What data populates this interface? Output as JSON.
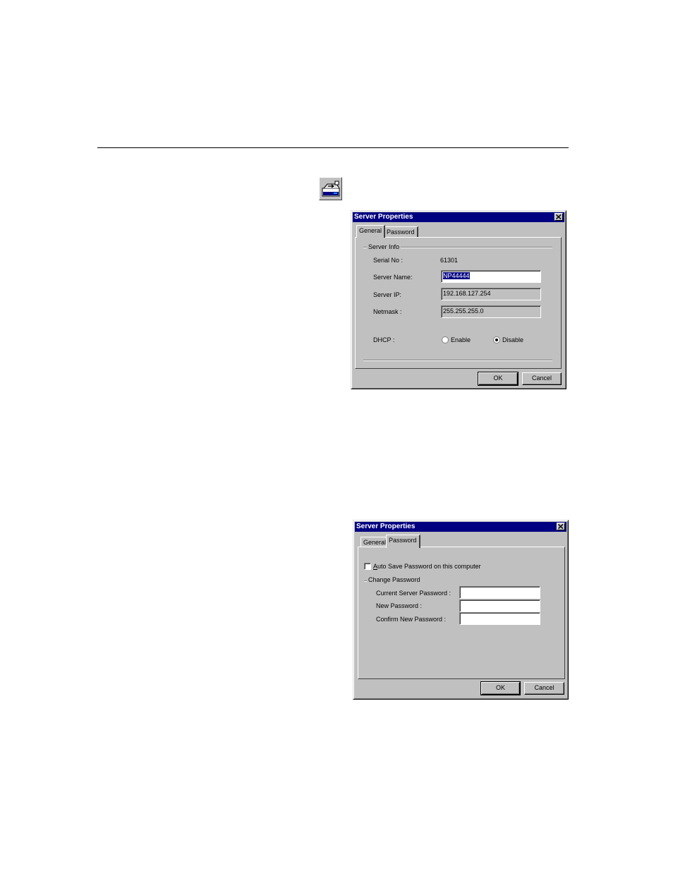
{
  "dialog1": {
    "title": "Server Properties",
    "tabs": [
      "General",
      "Password"
    ],
    "group_label": "Server Info",
    "serial_label": "Serial No :",
    "serial_value": "61301",
    "server_name_label": "Server Name:",
    "server_name_value": "NP44444",
    "server_ip_label": "Server IP:",
    "server_ip_value": "192.168.127.254",
    "netmask_label": "Netmask :",
    "netmask_value": "255.255.255.0",
    "dhcp_label": "DHCP :",
    "enable_label": "Enable",
    "disable_label": "Disable",
    "ok_label": "OK",
    "cancel_label": "Cancel"
  },
  "dialog2": {
    "title": "Server Properties",
    "tabs": [
      "General",
      "Password"
    ],
    "auto_save_first": "A",
    "auto_save_rest": "uto Save Password on this computer",
    "group_label": "Change Password",
    "current_label": "Current Server Password :",
    "new_label": "New Password :",
    "confirm_label": "Confirm New Password :",
    "ok_label": "OK",
    "cancel_label": "Cancel"
  },
  "icons": {
    "toolbar": "server-properties-icon",
    "close": "close-icon"
  }
}
